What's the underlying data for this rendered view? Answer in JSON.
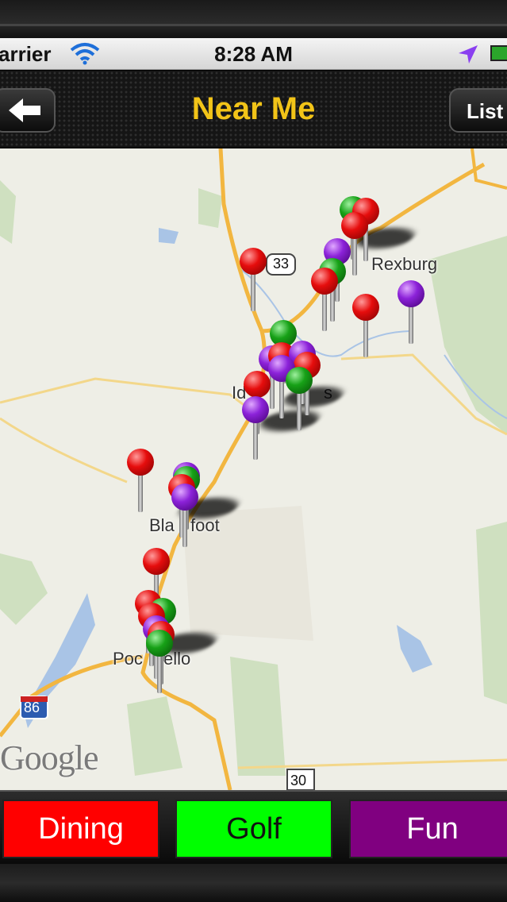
{
  "status_bar": {
    "carrier": "arrier",
    "time": "8:28 AM"
  },
  "nav": {
    "title": "Near Me",
    "list_label": "List",
    "back_icon": "left-arrow-icon"
  },
  "map": {
    "place_labels": [
      "Rexburg",
      "Id",
      "s",
      "Bla",
      "foot",
      "Poc",
      "ello"
    ],
    "route_shields": [
      "33",
      "86",
      "30"
    ],
    "attribution": "Google"
  },
  "categories": {
    "dining": {
      "label": "Dining",
      "color": "#ff0000"
    },
    "golf": {
      "label": "Golf",
      "color": "#00ff00"
    },
    "fun": {
      "label": "Fun",
      "color": "#800080"
    }
  }
}
